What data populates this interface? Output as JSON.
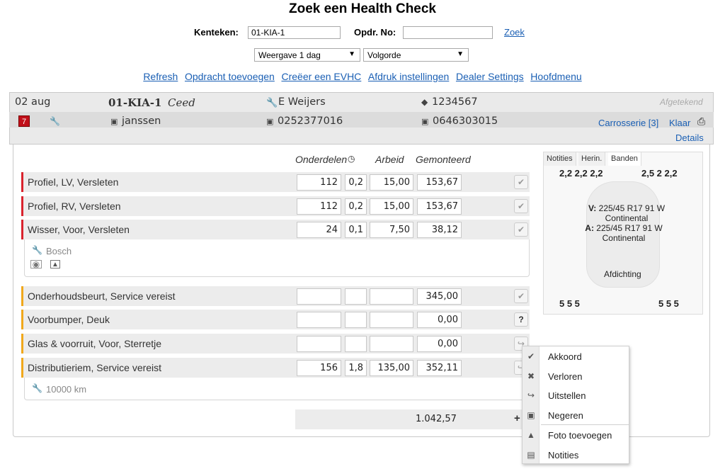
{
  "page_title": "Zoek een Health Check",
  "search": {
    "kenteken_label": "Kenteken:",
    "kenteken_value": "01-KIA-1",
    "opdr_label": "Opdr. No:",
    "opdr_value": "",
    "zoek_label": "Zoek",
    "weergave_selected": "Weergave 1 dag",
    "volgorde_selected": "Volgorde"
  },
  "nav_links": [
    "Refresh",
    "Opdracht toevoegen",
    "Creëer een EVHC",
    "Afdruk instellingen",
    "Dealer Settings",
    "Hoofdmenu"
  ],
  "header": {
    "date": "02 aug",
    "kenteken": "01-KIA-1",
    "model": "Ceed",
    "mechanic": "E Weijers",
    "order_no": "1234567",
    "status": "Afgetekend",
    "badge_count": "7",
    "customer": "janssen",
    "phone1": "0252377016",
    "phone2": "0646303015",
    "carrosserie": "Carrosserie [3]",
    "klaar": "Klaar",
    "details": "Details"
  },
  "columns": {
    "onderdelen": "Onderdelen",
    "arbeid": "Arbeid",
    "gemonteerd": "Gemonteerd"
  },
  "items": [
    {
      "label": "Profiel, LV, Versleten",
      "onderdelen": "112",
      "uren": "0,2",
      "arbeid": "15,00",
      "gemonteerd": "153,67",
      "action": "✔"
    },
    {
      "label": "Profiel, RV, Versleten",
      "onderdelen": "112",
      "uren": "0,2",
      "arbeid": "15,00",
      "gemonteerd": "153,67",
      "action": "✔"
    },
    {
      "label": "Wisser, Voor, Versleten",
      "onderdelen": "24",
      "uren": "0,1",
      "arbeid": "7,50",
      "gemonteerd": "38,12",
      "action": "✔",
      "detail": "Bosch"
    },
    {
      "label": "Onderhoudsbeurt, Service vereist",
      "onderdelen": "",
      "uren": "",
      "arbeid": "",
      "gemonteerd": "345,00",
      "action": "✔"
    },
    {
      "label": "Voorbumper, Deuk",
      "onderdelen": "",
      "uren": "",
      "arbeid": "",
      "gemonteerd": "0,00",
      "action": "?"
    },
    {
      "label": "Glas & voorruit, Voor, Sterretje",
      "onderdelen": "",
      "uren": "",
      "arbeid": "",
      "gemonteerd": "0,00",
      "action": "↪"
    },
    {
      "label": "Distributieriem, Service vereist",
      "onderdelen": "156",
      "uren": "1,8",
      "arbeid": "135,00",
      "gemonteerd": "352,11",
      "action": "↪",
      "detail": "10000 km"
    }
  ],
  "total": "1.042,57",
  "tabs": [
    "Notities",
    "Herin.",
    "Banden"
  ],
  "tyres": {
    "top_left": "2,2  2,2  2,2",
    "top_right": "2,5  2  2,2",
    "bottom_left": "5  5  5",
    "bottom_right": "5  5  5",
    "front_label": "V:",
    "front_size": "225/45 R17 91 W",
    "front_brand": "Continental",
    "rear_label": "A:",
    "rear_size": "225/45 R17 91 W",
    "rear_brand": "Continental",
    "afdichting": "Afdichting"
  },
  "context_menu": [
    "Akkoord",
    "Verloren",
    "Uitstellen",
    "Negeren",
    "Foto toevoegen",
    "Notities"
  ]
}
